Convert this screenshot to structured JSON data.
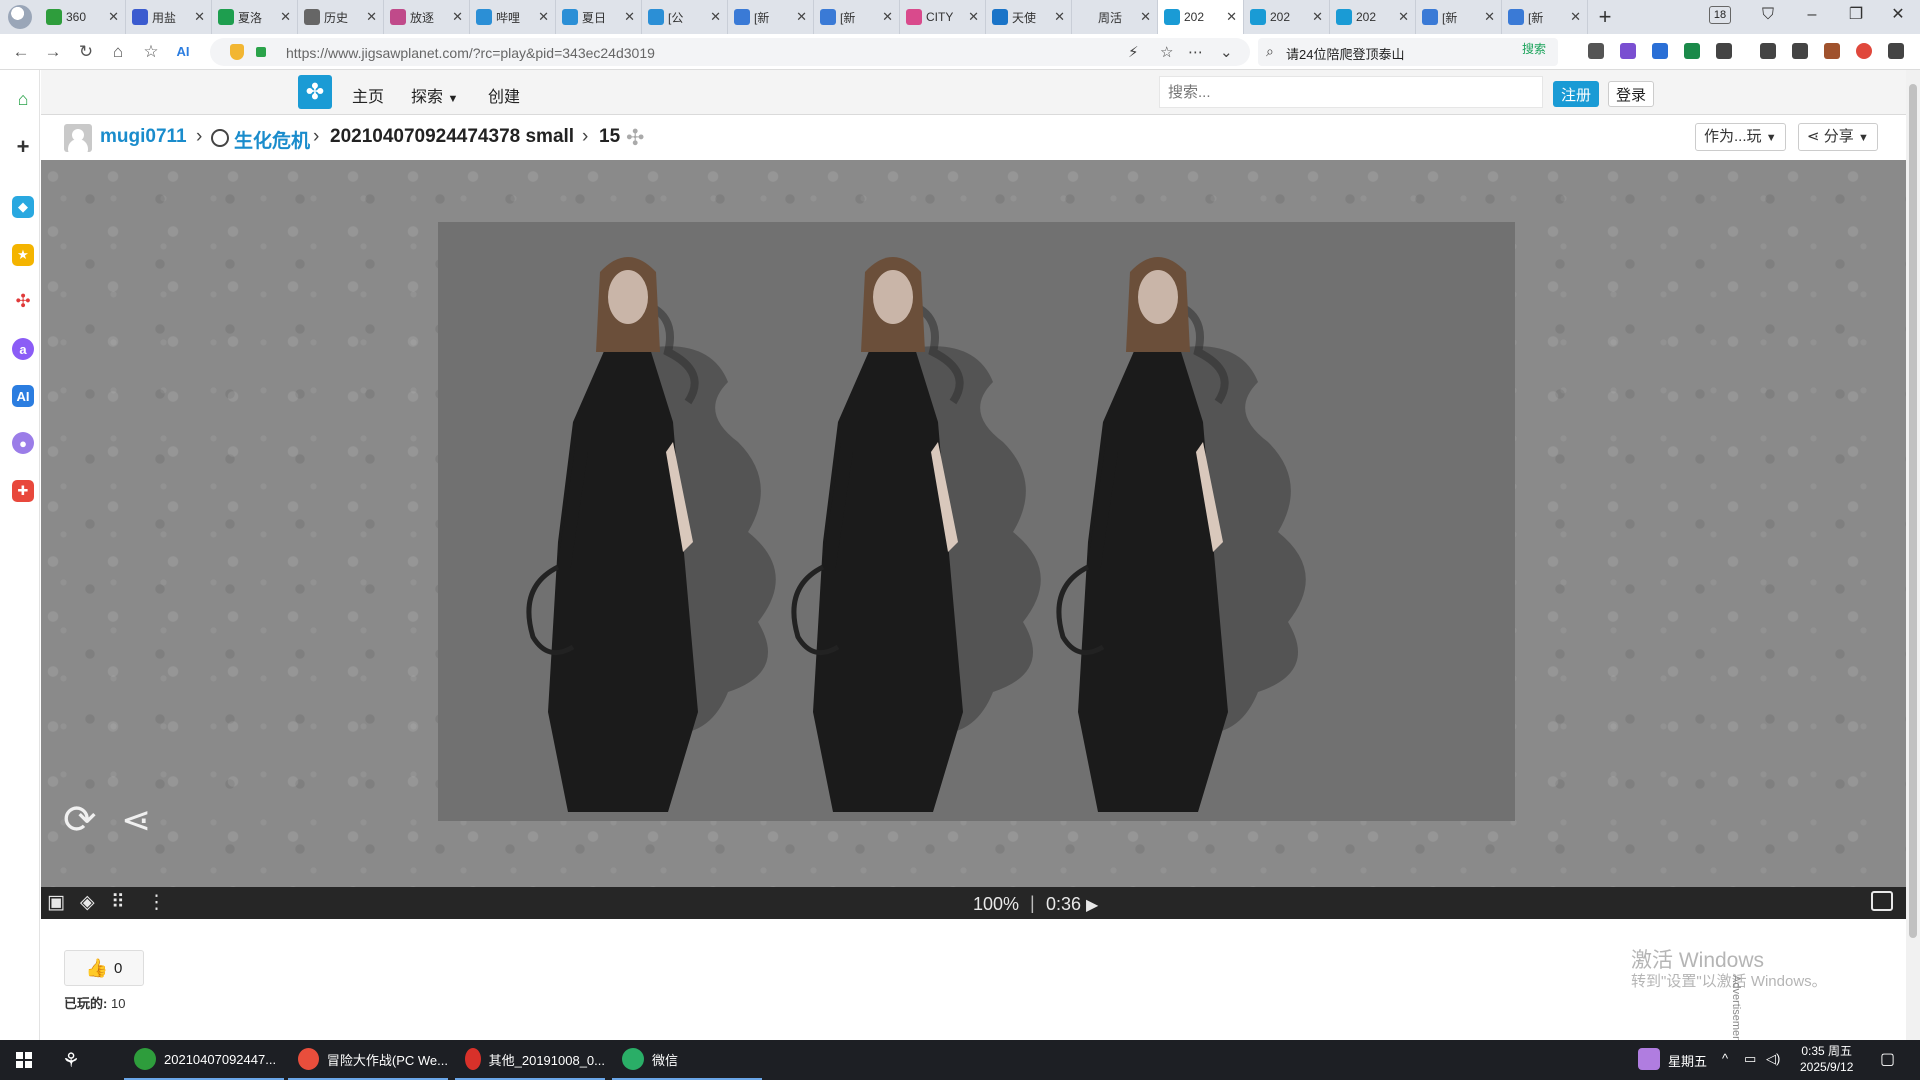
{
  "browser": {
    "tabs": [
      {
        "label": "360",
        "color": "#2e9d3c"
      },
      {
        "label": "用盐",
        "color": "#3b5bcf"
      },
      {
        "label": "夏洛",
        "color": "#1e9e4f"
      },
      {
        "label": "历史",
        "color": "#666666"
      },
      {
        "label": "放逐",
        "color": "#c04a8a"
      },
      {
        "label": "哔哩",
        "color": "#2b8fd6"
      },
      {
        "label": "夏日",
        "color": "#2b8fd6"
      },
      {
        "label": "[公",
        "color": "#2b8fd6"
      },
      {
        "label": "[新",
        "color": "#3a7ad6"
      },
      {
        "label": "[新",
        "color": "#3a7ad6"
      },
      {
        "label": "CITY",
        "color": "#d94a8c"
      },
      {
        "label": "天使",
        "color": "#1a74c8"
      },
      {
        "label": "周活",
        "color": "#dfe3ea"
      },
      {
        "label": "202",
        "color": "#1a9bd5",
        "active": true
      },
      {
        "label": "202",
        "color": "#1a9bd5"
      },
      {
        "label": "202",
        "color": "#1a9bd5"
      },
      {
        "label": "[新",
        "color": "#3a7ad6"
      },
      {
        "label": "[新",
        "color": "#3a7ad6"
      }
    ],
    "tab_count": "18",
    "url": "https://www.jigsawplanet.com/?rc=play&pid=343ec24d3019",
    "search_query": "请24位陪爬登顶泰山",
    "search_button": "搜索"
  },
  "site": {
    "nav": {
      "home": "主页",
      "explore": "探索",
      "create": "创建"
    },
    "search_placeholder": "搜索...",
    "register": "注册",
    "login": "登录"
  },
  "breadcrumb": {
    "user": "mugi0711",
    "folder": "生化危机",
    "puzzle": "202104070924474378 small",
    "pieces": "15",
    "play_as": "作为...玩",
    "share": "分享"
  },
  "toolbar": {
    "progress": "100%",
    "separator": "|",
    "timer": "0:36"
  },
  "stats": {
    "likes": "0",
    "plays_label": "已玩的:",
    "plays_count": "10"
  },
  "watermark": {
    "title": "激活 Windows",
    "subtitle": "转到\"设置\"以激活 Windows。",
    "advert": "Advertisement"
  },
  "taskbar": {
    "items": [
      {
        "label": "20210407092447...",
        "color": "#2e9d3c"
      },
      {
        "label": "冒险大作战(PC We...",
        "color": "#e94e3c"
      },
      {
        "label": "其他_20191008_0...",
        "color": "#d8312a"
      },
      {
        "label": "微信",
        "color": "#2aae67"
      }
    ],
    "weekday": "星期五",
    "time": "0:35 周五",
    "date": "2025/9/12"
  },
  "colors": {
    "accent": "#1a9bd5",
    "stage": "#8a8a8a",
    "toolbar": "#262626"
  },
  "icons": [
    "home-icon",
    "plus-icon",
    "globe-icon",
    "puzzle-piece-icon",
    "restart-icon",
    "share-icon",
    "image-icon",
    "shape-icon",
    "grid-icon",
    "more-icon",
    "play-icon",
    "fullscreen-icon",
    "thumbs-up-icon"
  ]
}
